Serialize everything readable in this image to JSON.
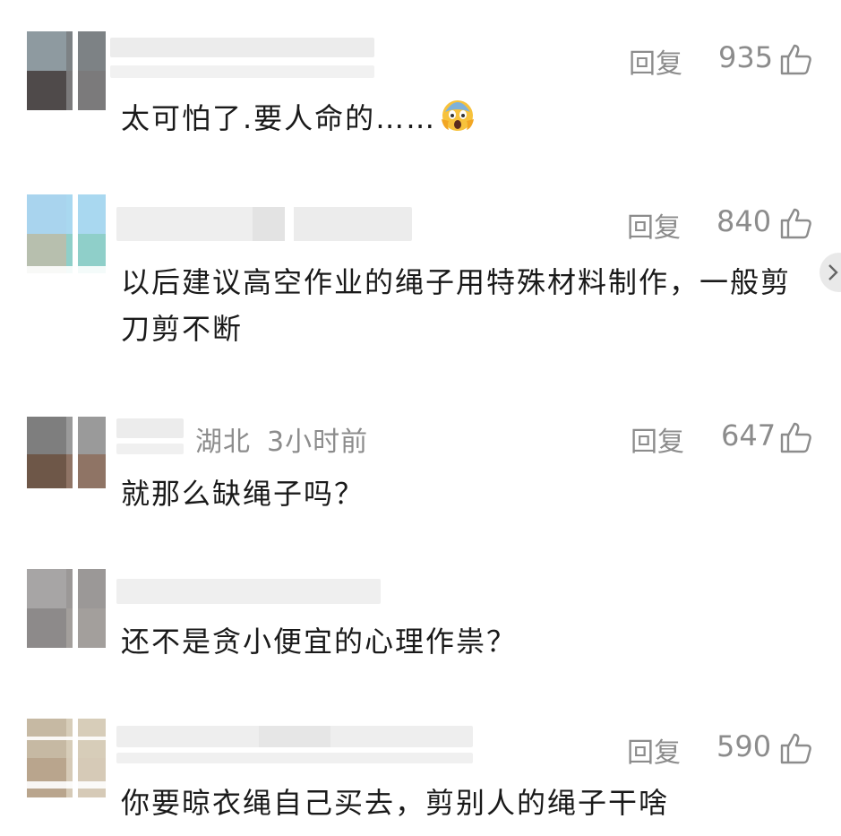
{
  "comments": [
    {
      "reply_label": "回复",
      "likes": "935",
      "text": "太可怕了.要人命的……",
      "emoji": "scream-emoji"
    },
    {
      "reply_label": "回复",
      "likes": "840",
      "text": "以后建议高空作业的绳子用特殊材料制作，一般剪刀剪不断"
    },
    {
      "location": "湖北",
      "time": "3小时前",
      "reply_label": "回复",
      "likes": "647",
      "text": "就那么缺绳子吗？"
    },
    {
      "text": "还不是贪小便宜的心理作祟？"
    },
    {
      "reply_label": "回复",
      "likes": "590",
      "text": "你要晾衣绳自己买去，剪别人的绳子干啥"
    }
  ],
  "icons": {
    "like": "thumbs-up-icon",
    "side": "chevron-right-icon"
  },
  "colors": {
    "meta_gray": "#8c8c8c",
    "text": "#1a1a1a",
    "background": "#ffffff"
  }
}
